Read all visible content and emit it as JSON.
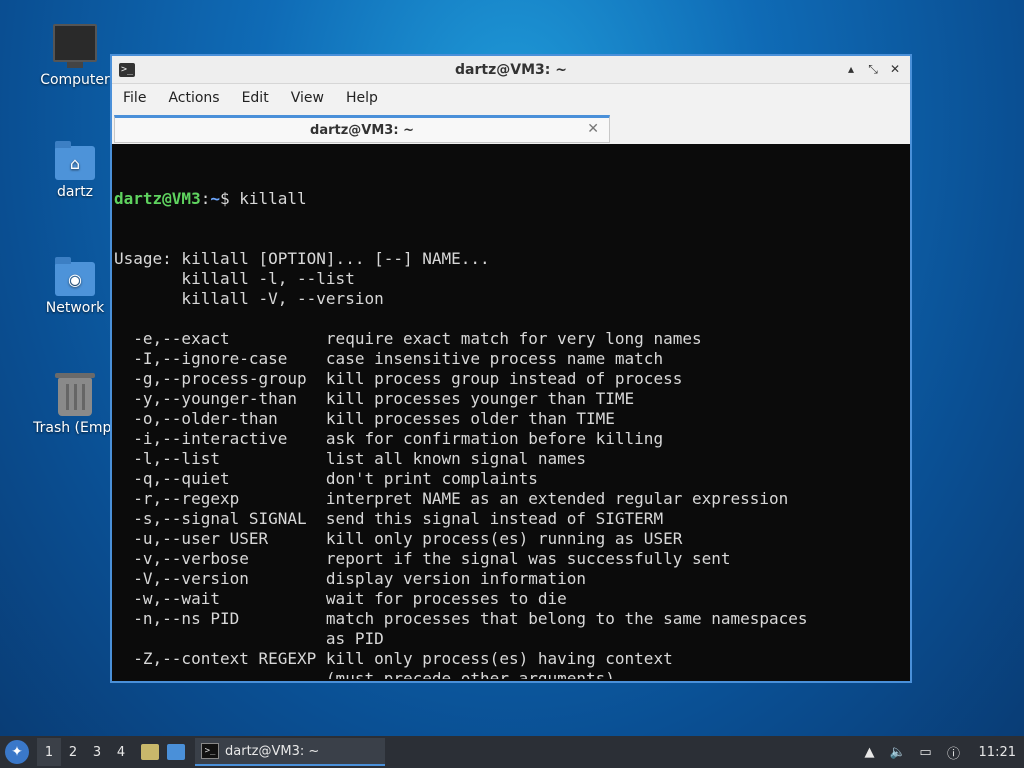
{
  "desktop": {
    "icons": [
      {
        "label": "Computer"
      },
      {
        "label": "dartz"
      },
      {
        "label": "Network"
      },
      {
        "label": "Trash (Empt"
      }
    ]
  },
  "window": {
    "title": "dartz@VM3: ~",
    "icon": "terminal-icon",
    "controls": {
      "minimize": "▴",
      "maximize": "⤡",
      "close": "✕"
    },
    "menu": [
      "File",
      "Actions",
      "Edit",
      "View",
      "Help"
    ],
    "tab": {
      "label": "dartz@VM3: ~",
      "close": "✕"
    }
  },
  "terminal": {
    "prompt_user": "dartz@VM3",
    "prompt_colon": ":",
    "prompt_path": "~",
    "prompt_symbol": "$ ",
    "command": "killall",
    "output": [
      "Usage: killall [OPTION]... [--] NAME...",
      "       killall -l, --list",
      "       killall -V, --version",
      "",
      "  -e,--exact          require exact match for very long names",
      "  -I,--ignore-case    case insensitive process name match",
      "  -g,--process-group  kill process group instead of process",
      "  -y,--younger-than   kill processes younger than TIME",
      "  -o,--older-than     kill processes older than TIME",
      "  -i,--interactive    ask for confirmation before killing",
      "  -l,--list           list all known signal names",
      "  -q,--quiet          don't print complaints",
      "  -r,--regexp         interpret NAME as an extended regular expression",
      "  -s,--signal SIGNAL  send this signal instead of SIGTERM",
      "  -u,--user USER      kill only process(es) running as USER",
      "  -v,--verbose        report if the signal was successfully sent",
      "  -V,--version        display version information",
      "  -w,--wait           wait for processes to die",
      "  -n,--ns PID         match processes that belong to the same namespaces",
      "                      as PID",
      "  -Z,--context REGEXP kill only process(es) having context",
      "                      (must precede other arguments)",
      ""
    ]
  },
  "taskbar": {
    "workspaces": [
      "1",
      "2",
      "3",
      "4"
    ],
    "active_workspace": "1",
    "task_label": "dartz@VM3: ~",
    "clock": "11:21",
    "accent": "#4a90d9"
  }
}
